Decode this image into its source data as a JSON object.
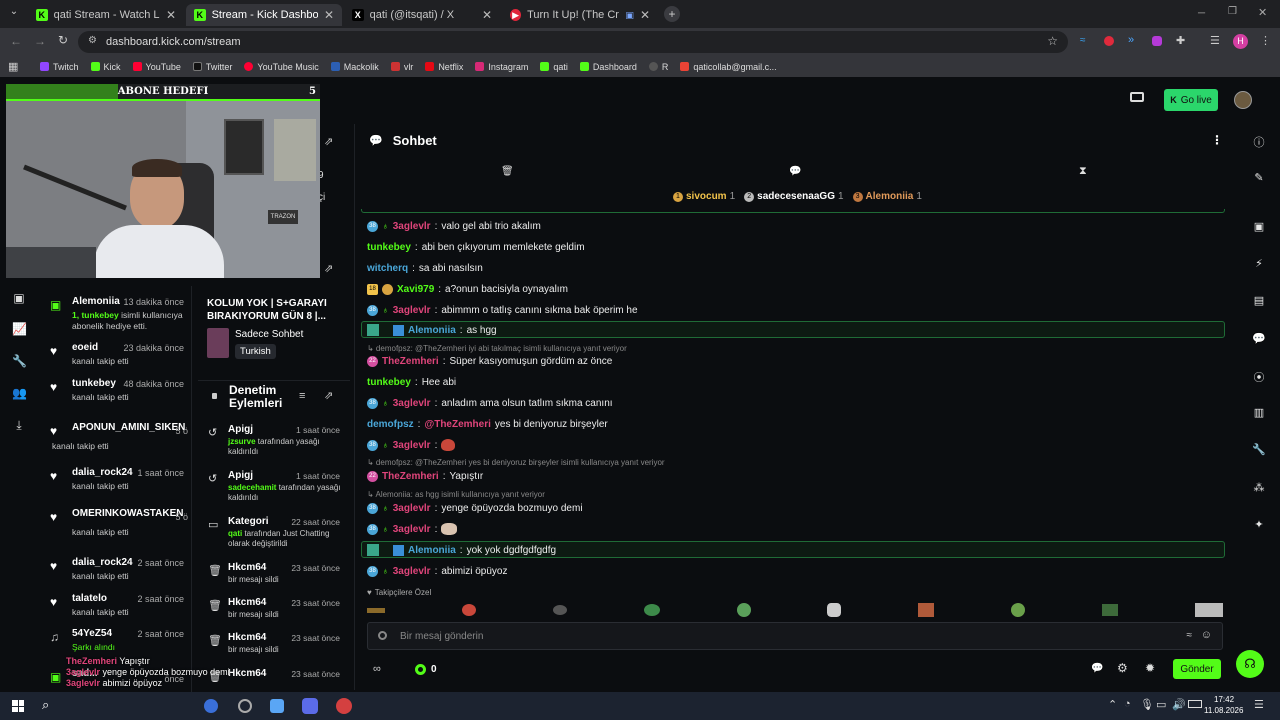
{
  "browser": {
    "tabs": [
      {
        "title": "qati Stream - Watch Live on Ki..."
      },
      {
        "title": "Stream - Kick Dashboard"
      },
      {
        "title": "qati (@itsqati) / X"
      },
      {
        "title": "Turn It Up! (The Crew Mot..."
      }
    ],
    "url": "dashboard.kick.com/stream",
    "bookmarks": [
      "Twitch",
      "Kick",
      "YouTube",
      "Twitter",
      "YouTube Music",
      "Mackolik",
      "vlr",
      "Netflix",
      "Instagram",
      "qati",
      "Dashboard",
      "R",
      "qaticollab@gmail.c..."
    ],
    "profile_initial": "H"
  },
  "overlay": {
    "sub_goal": "ABONE HEDEFI",
    "sub_goal_count": "5",
    "desk_sign": "TRAZON"
  },
  "header": {
    "go_live": "Go live"
  },
  "activity": [
    {
      "name": "Alemoniia",
      "time": "13 dakika önce",
      "desc_hl": "1, tunkebey",
      "desc": " isimli kullanıcıya abonelik hediye etti.",
      "icon": "gift-icon"
    },
    {
      "name": "eoeid",
      "time": "23 dakika önce",
      "desc": "kanalı takip etti",
      "icon": "heart-icon"
    },
    {
      "name": "tunkebey",
      "time": "48 dakika önce",
      "desc": "kanalı takip etti",
      "icon": "heart-icon"
    },
    {
      "name": "APONUN_AMINI_SIKEN",
      "time": "5 ö",
      "desc": "kanalı takip etti",
      "icon": "heart-icon"
    },
    {
      "name": "dalia_rock24",
      "time": "1 saat önce",
      "desc": "kanalı takip etti",
      "icon": "heart-icon"
    },
    {
      "name": "OMERINKOWASTAKEN",
      "time": "5 ö",
      "desc": "kanalı takip etti",
      "icon": "heart-icon"
    },
    {
      "name": "dalia_rock24",
      "time": "2 saat önce",
      "desc": "kanalı takip etti",
      "icon": "heart-icon"
    },
    {
      "name": "talatelo",
      "time": "2 saat önce",
      "desc": "kanalı takip etti",
      "icon": "heart-icon"
    },
    {
      "name": "54YeZ54",
      "time": "2 saat önce",
      "desc": "Şarkı alındı",
      "icon": "music-icon"
    },
    {
      "name": "sad...",
      "time": "önce",
      "desc": "",
      "icon": "gift-icon"
    }
  ],
  "stream_info": {
    "partial_count": "9",
    "partial_text": "çi",
    "title": "KOLUM YOK | S+GARAYI BIRAKIYORUM GÜN 8 |...",
    "category": "Sadece Sohbet",
    "language": "Turkish"
  },
  "moderation": {
    "title": "Denetim Eylemleri",
    "items": [
      {
        "name": "Apigj",
        "time": "1 saat önce",
        "desc_hl": "jzsurve",
        "desc": " tarafından yasağı kaldırıldı",
        "icon": "undo-icon"
      },
      {
        "name": "Apigj",
        "time": "1 saat önce",
        "desc_hl": "sadecehamit",
        "desc": " tarafından yasağı kaldırıldı",
        "icon": "undo-icon"
      },
      {
        "name": "Kategori",
        "time": "22 saat önce",
        "desc_hl": "qati",
        "desc": " tarafından Just Chatting olarak değiştirildi",
        "icon": "category-icon"
      },
      {
        "name": "Hkcm64",
        "time": "23 saat önce",
        "desc": "bir mesajı sildi",
        "icon": "trash-icon"
      },
      {
        "name": "Hkcm64",
        "time": "23 saat önce",
        "desc": "bir mesajı sildi",
        "icon": "trash-icon"
      },
      {
        "name": "Hkcm64",
        "time": "23 saat önce",
        "desc": "bir mesajı sildi",
        "icon": "trash-icon"
      },
      {
        "name": "Hkcm64",
        "time": "23 saat önce",
        "desc": "",
        "icon": "trash-icon"
      }
    ]
  },
  "chat": {
    "title": "Sohbet",
    "leaderboard": [
      {
        "rank": "1",
        "name": "sivocum",
        "count": "1"
      },
      {
        "rank": "2",
        "name": "sadecesenaaGG",
        "count": "1"
      },
      {
        "rank": "3",
        "name": "Alemoniia",
        "count": "1"
      }
    ],
    "messages": [
      {
        "badge": "38",
        "user": "3aglevlr",
        "color": "#e0457b",
        "text": "valo gel abi trio akalım"
      },
      {
        "badge": "",
        "user": "tunkebey",
        "color": "#53fc18",
        "text": "abi ben çıkıyorum memlekete geldim"
      },
      {
        "badge": "",
        "user": "witcherq",
        "color": "#4aa6d8",
        "text": "sa abi nasılsın"
      },
      {
        "badge": "18",
        "user": "Xavi979",
        "color": "#53fc18",
        "text": "a?onun bacisiyla oynayalım"
      },
      {
        "badge": "38",
        "user": "3aglevlr",
        "color": "#e0457b",
        "text": "abimmm o tatlış canını sıkma bak öperim he"
      },
      {
        "badge": "",
        "user": "Alemoniia",
        "color": "#4aa6d8",
        "text": "as hgg"
      },
      {
        "reply": "↳ demofpsz: @TheZemheri iyi abi takılmaç isimli kullanıcıya yanıt veriyor"
      },
      {
        "badge": "22",
        "user": "TheZemheri",
        "color": "#e0457b",
        "text": "Süper kasıyomuşun gördüm az önce"
      },
      {
        "badge": "",
        "user": "tunkebey",
        "color": "#53fc18",
        "text": "Hee abi"
      },
      {
        "badge": "38",
        "user": "3aglevlr",
        "color": "#e0457b",
        "text": "anladım ama olsun tatlım sıkma canını"
      },
      {
        "badge": "",
        "user": "demofpsz",
        "color": "#4aa6d8",
        "text": "yes bi deniyoruz birşeyler",
        "mention": "@TheZemheri"
      },
      {
        "badge": "38",
        "user": "3aglevlr",
        "color": "#e0457b",
        "text": "",
        "emote": true
      },
      {
        "reply": "↳ demofpsz: @TheZemheri yes bi deniyoruz birşeyler isimli kullanıcıya yanıt veriyor"
      },
      {
        "badge": "22",
        "user": "TheZemheri",
        "color": "#e0457b",
        "text": "Yapıştır"
      },
      {
        "reply": "↳ Alemoniia: as hgg isimli kullanıcıya yanıt veriyor"
      },
      {
        "badge": "38",
        "user": "3aglevlr",
        "color": "#e0457b",
        "text": "yenge öpüyozda bozmuyo demi"
      },
      {
        "badge": "38",
        "user": "3aglevlr",
        "color": "#e0457b",
        "text": "",
        "emote": true
      },
      {
        "badge": "",
        "user": "Alemoniia",
        "color": "#4aa6d8",
        "text": "yok yok dgdfgdfgdfg"
      },
      {
        "badge": "38",
        "user": "3aglevlr",
        "color": "#e0457b",
        "text": "abimizi öpüyoz"
      }
    ],
    "followers_label": "Takipçilere Özel",
    "input_placeholder": "Bir mesaj gönderin",
    "points": "0",
    "send": "Gönder"
  },
  "overlay_chat": [
    {
      "user": "TheZemheri",
      "text": "Yapıştır"
    },
    {
      "user": "3aglevlr",
      "text": "yenge öpüyozda bozmuyo demi"
    },
    {
      "user": "3aglevlr",
      "text": "abimizi öpüyoz"
    }
  ],
  "taskbar": {
    "time": "17:42",
    "date": "11.08.2026"
  },
  "colors": {
    "brand": "#53fc18",
    "bg": "#0b0d10"
  }
}
